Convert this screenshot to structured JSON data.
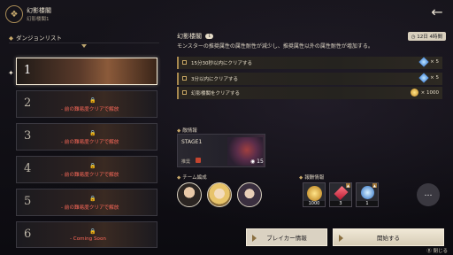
{
  "header": {
    "title": "幻影楼閣",
    "subtitle": "幻影楼閣1",
    "emblem": "ornament-icon"
  },
  "left": {
    "list_title": "ダンジョンリスト",
    "stages": [
      {
        "num": "1",
        "state": "active"
      },
      {
        "num": "2",
        "state": "locked",
        "cond": "- 前の難易度クリアで解放"
      },
      {
        "num": "3",
        "state": "locked",
        "cond": "- 前の難易度クリアで解放"
      },
      {
        "num": "4",
        "state": "locked",
        "cond": "- 前の難易度クリアで解放"
      },
      {
        "num": "5",
        "state": "locked",
        "cond": "- 前の難易度クリアで解放"
      },
      {
        "num": "6",
        "state": "soon",
        "cond": "- Coming Soon"
      }
    ]
  },
  "detail": {
    "title": "幻影楼閣",
    "title_badge": "1",
    "time_left": "12日 4時間",
    "description": "モンスターの推奨属性の属性耐性が減少し、推奨属性以外の属性耐性が増加する。",
    "missions": [
      {
        "text": "15分30秒以内にクリアする",
        "reward": "× 5",
        "reward_icon": "gem-icon"
      },
      {
        "text": "3分以内にクリアする",
        "reward": "× 5",
        "reward_icon": "gem-icon"
      },
      {
        "text": "幻影楼閣をクリアする",
        "reward": "× 1000",
        "reward_icon": "coin-icon"
      }
    ],
    "enemy_label": "敵情報",
    "enemy": {
      "stage": "STAGE1",
      "recommend": "推奨",
      "count": "15"
    },
    "team_label": "チーム編成",
    "rewards_label": "報酬情報",
    "rewards": [
      {
        "qty": "1000",
        "icon": "coin-icon",
        "color": "#d3a13b"
      },
      {
        "qty": "3",
        "icon": "crystal-icon",
        "color": "#d9324a"
      },
      {
        "qty": "1",
        "icon": "orb-icon",
        "color": "#3a8bd8"
      }
    ],
    "more_label": "…"
  },
  "buttons": {
    "breaker": "ブレイカー情報",
    "start": "開始する",
    "close": "閉じる"
  }
}
